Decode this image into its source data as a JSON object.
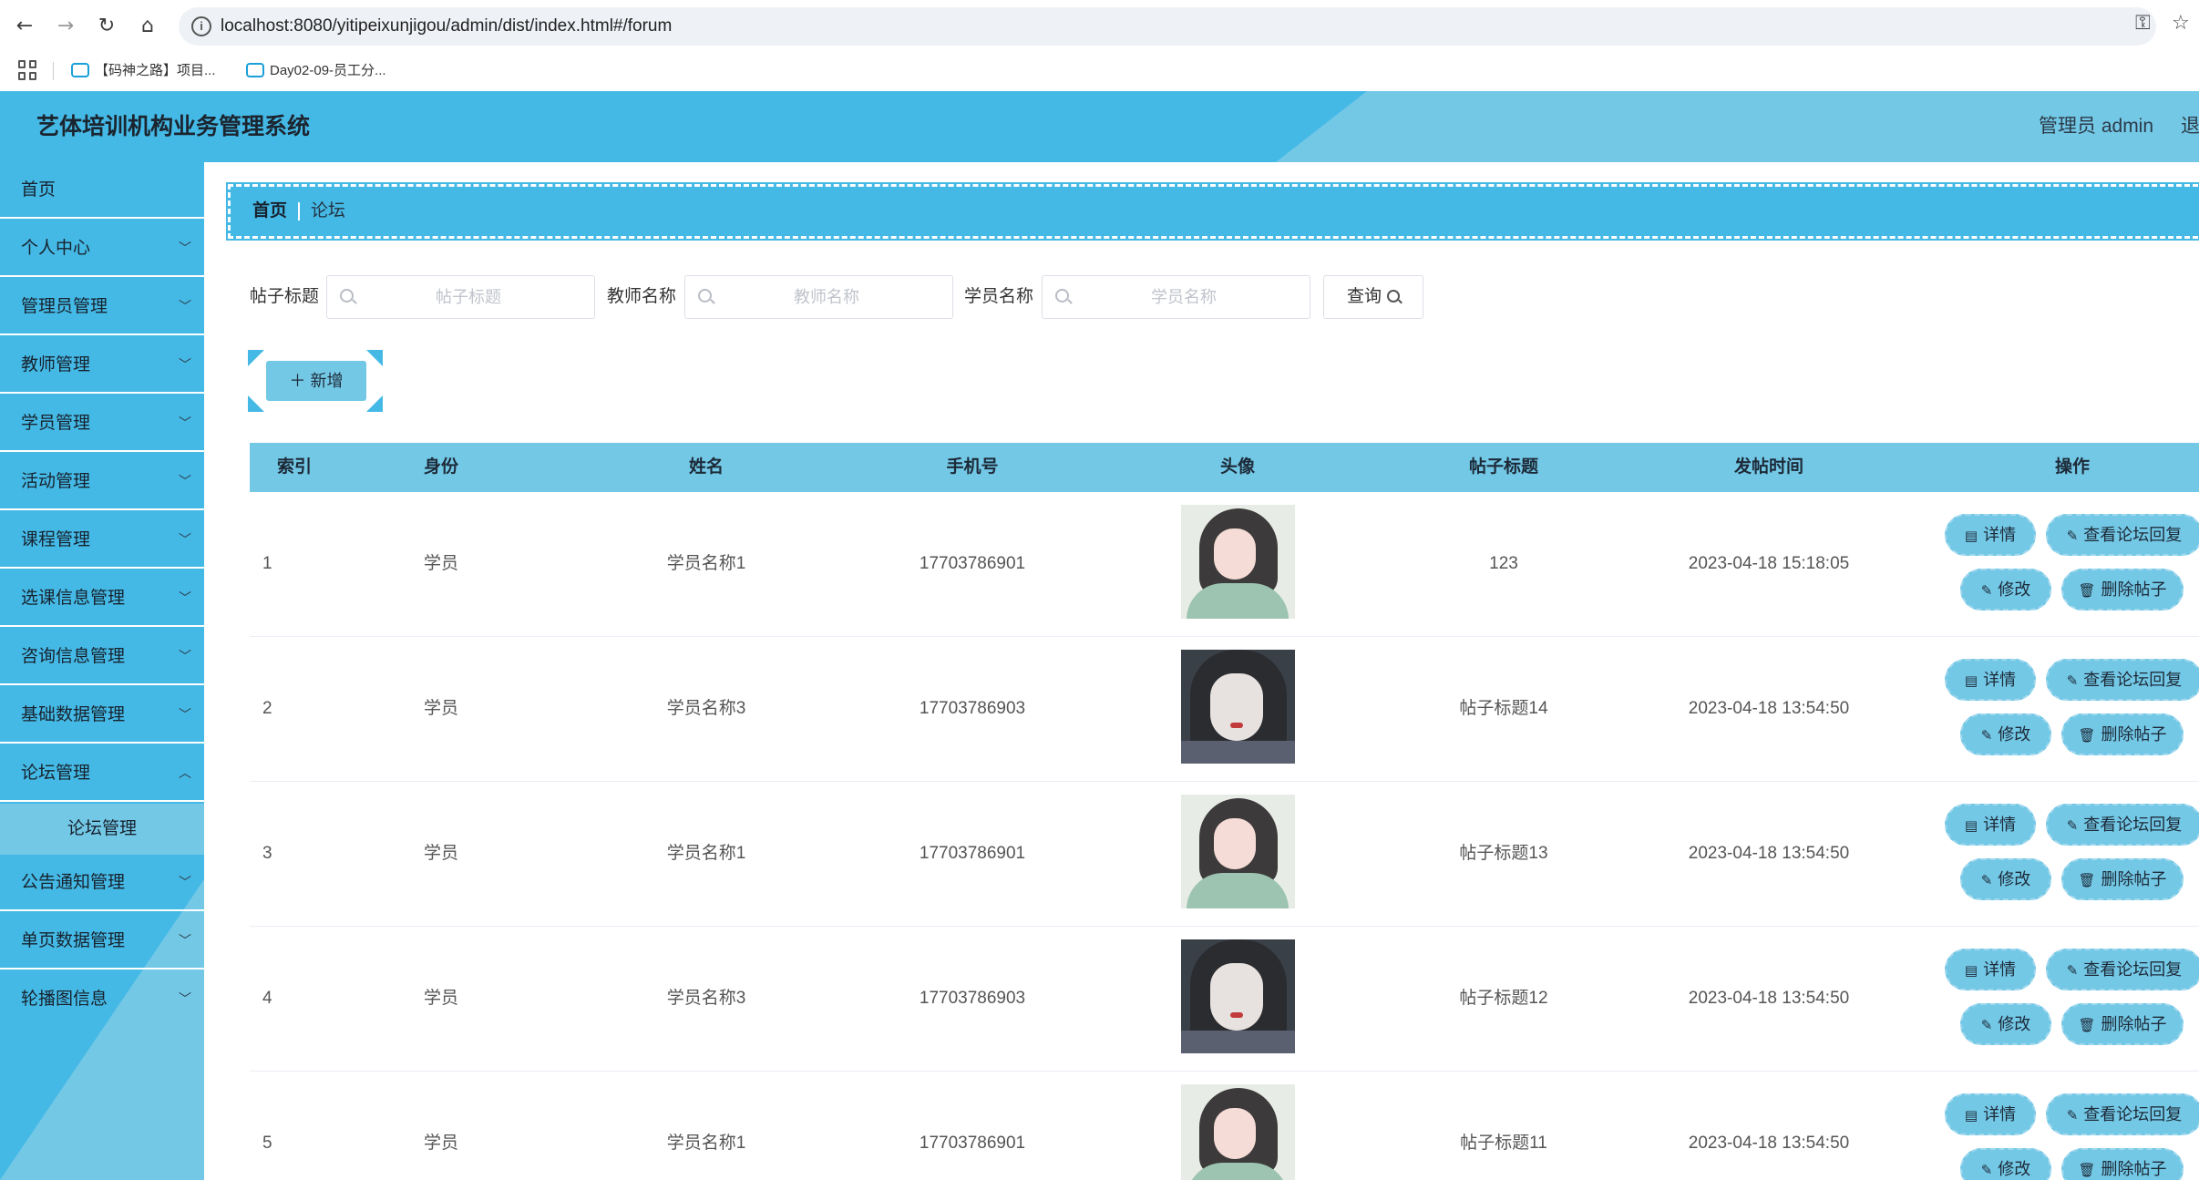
{
  "browser": {
    "url": "localhost:8080/yitipeixunjigou/admin/dist/index.html#/forum",
    "bookmarks": [
      "【码神之路】项目...",
      "Day02-09-员工分..."
    ]
  },
  "header": {
    "title": "艺体培训机构业务管理系统",
    "admin": "管理员 admin",
    "logout": "退"
  },
  "sidebar": {
    "items": [
      {
        "label": "首页"
      },
      {
        "label": "个人中心"
      },
      {
        "label": "管理员管理"
      },
      {
        "label": "教师管理"
      },
      {
        "label": "学员管理"
      },
      {
        "label": "活动管理"
      },
      {
        "label": "课程管理"
      },
      {
        "label": "选课信息管理"
      },
      {
        "label": "咨询信息管理"
      },
      {
        "label": "基础数据管理"
      },
      {
        "label": "论坛管理"
      },
      {
        "label": "公告通知管理"
      },
      {
        "label": "单页数据管理"
      },
      {
        "label": "轮播图信息"
      }
    ],
    "sub_item": "论坛管理"
  },
  "breadcrumb": {
    "home": "首页",
    "current": "论坛"
  },
  "search": {
    "title_label": "帖子标题",
    "title_placeholder": "帖子标题",
    "teacher_label": "教师名称",
    "teacher_placeholder": "教师名称",
    "student_label": "学员名称",
    "student_placeholder": "学员名称",
    "query_label": "查询"
  },
  "add_label": "新增",
  "table": {
    "columns": [
      "索引",
      "身份",
      "姓名",
      "手机号",
      "头像",
      "帖子标题",
      "发帖时间",
      "操作"
    ],
    "rows": [
      {
        "index": "1",
        "role": "学员",
        "name": "学员名称1",
        "phone": "17703786901",
        "title": "123",
        "time": "2023-04-18 15:18:05",
        "avatar": "student-avatar-1"
      },
      {
        "index": "2",
        "role": "学员",
        "name": "学员名称3",
        "phone": "17703786903",
        "title": "帖子标题14",
        "time": "2023-04-18 13:54:50",
        "avatar": "student-avatar-3"
      },
      {
        "index": "3",
        "role": "学员",
        "name": "学员名称1",
        "phone": "17703786901",
        "title": "帖子标题13",
        "time": "2023-04-18 13:54:50",
        "avatar": "student-avatar-1"
      },
      {
        "index": "4",
        "role": "学员",
        "name": "学员名称3",
        "phone": "17703786903",
        "title": "帖子标题12",
        "time": "2023-04-18 13:54:50",
        "avatar": "student-avatar-3"
      },
      {
        "index": "5",
        "role": "学员",
        "name": "学员名称1",
        "phone": "17703786901",
        "title": "帖子标题11",
        "time": "2023-04-18 13:54:50",
        "avatar": "student-avatar-1"
      }
    ]
  },
  "actions": {
    "detail": "详情",
    "view_replies": "查看论坛回复",
    "edit": "修改",
    "delete": "删除帖子"
  },
  "colors": {
    "primary": "#45b9e5",
    "light": "#73c8e6"
  }
}
